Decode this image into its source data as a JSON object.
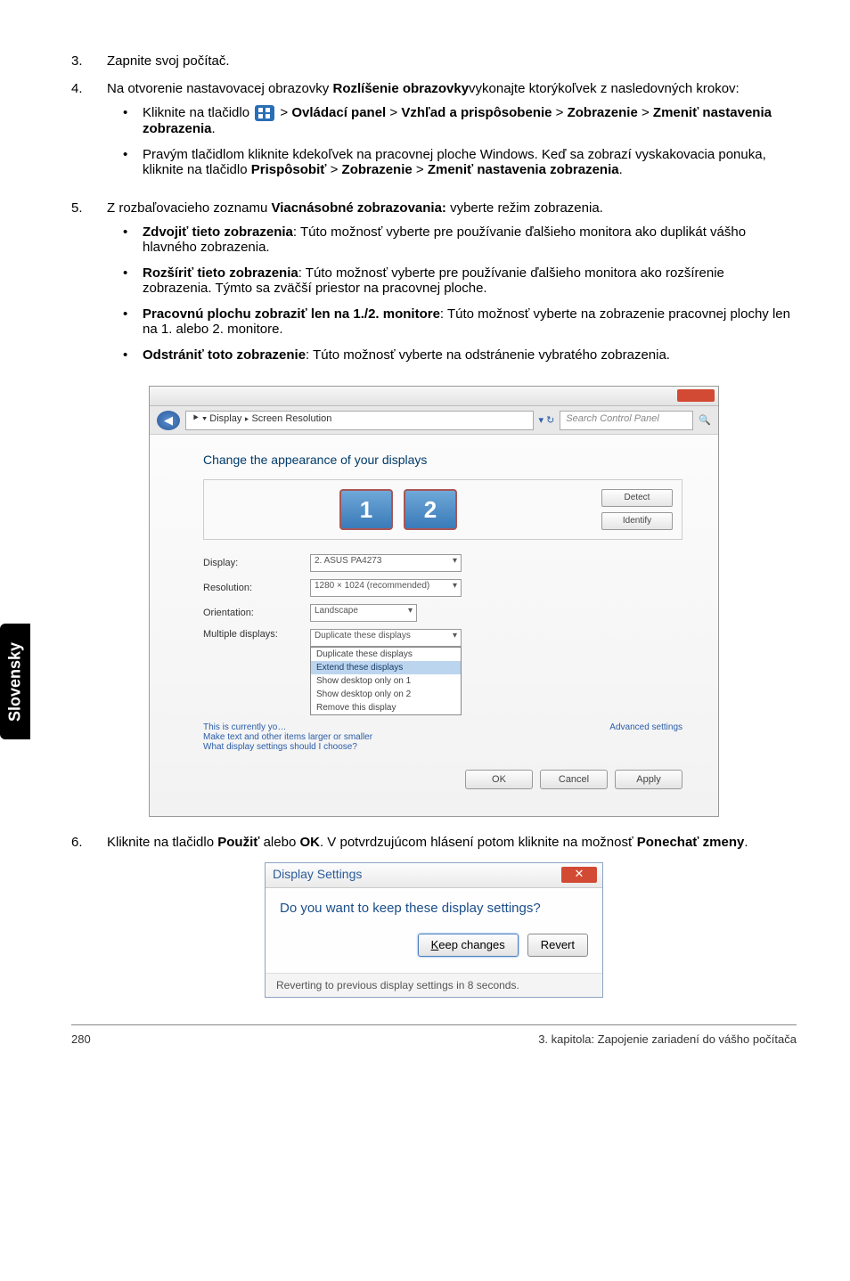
{
  "sideTab": "Slovensky",
  "steps": {
    "s3": {
      "num": "3.",
      "text": "Zapnite svoj počítač."
    },
    "s4": {
      "num": "4.",
      "textA": "Na otvorenie nastavovacej obrazovky ",
      "bold1": "Rozlíšenie obrazovky",
      "textB": "vykonajte ktorýkoľvek z nasledovných krokov:",
      "sub1": {
        "a": "Kliknite na tlačidlo ",
        "b": " > ",
        "c": "Ovládací panel",
        "d": " > ",
        "e": "Vzhľad a prispôsobenie",
        "f": " > ",
        "g": "Zobrazenie",
        "h": " > ",
        "i": "Zmeniť nastavenia zobrazenia",
        "j": "."
      },
      "sub2": {
        "a": "Pravým tlačidlom kliknite kdekoľvek na pracovnej ploche Windows. Keď sa zobrazí vyskakovacia ponuka, kliknite na tlačidlo ",
        "b": "Prispôsobiť",
        "c": " > ",
        "d": "Zobrazenie",
        "e": " > ",
        "f": "Zmeniť nastavenia zobrazenia",
        "g": "."
      }
    },
    "s5": {
      "num": "5.",
      "textA": "Z rozbaľovacieho zoznamu ",
      "bold1": "Viacnásobné zobrazovania:",
      "textB": " vyberte režim zobrazenia.",
      "opts": {
        "o1": {
          "b": "Zdvojiť tieto zobrazenia",
          "t": ": Túto možnosť vyberte pre používanie ďalšieho monitora ako duplikát vášho hlavného zobrazenia."
        },
        "o2": {
          "b": "Rozšíriť tieto zobrazenia",
          "t": ": Túto možnosť vyberte pre používanie ďalšieho monitora ako rozšírenie zobrazenia. Týmto sa zväčší priestor na pracovnej ploche."
        },
        "o3": {
          "b": "Pracovnú plochu zobraziť len na 1./2. monitore",
          "t": ": Túto možnosť vyberte na zobrazenie pracovnej plochy len na 1. alebo 2. monitore."
        },
        "o4": {
          "b": "Odstrániť toto zobrazenie",
          "t": ": Túto možnosť vyberte na odstránenie vybratého zobrazenia."
        }
      }
    },
    "s6": {
      "num": "6.",
      "a": "Kliknite na tlačidlo ",
      "b": "Použiť",
      "c": " alebo ",
      "d": "OK",
      "e": ". V potvrdzujúcom hlásení potom kliknite na možnosť ",
      "f": "Ponechať zmeny",
      "g": "."
    }
  },
  "ss1": {
    "breadcrumb": "⯈ ▾ Display ▸ Screen Resolution",
    "searchPlaceholder": "Search Control Panel",
    "heading": "Change the appearance of your displays",
    "mon1": "1",
    "mon2": "2",
    "btnDetect": "Detect",
    "btnIdentify": "Identify",
    "lblDisplay": "Display:",
    "valDisplay": "2. ASUS PA4273",
    "lblResolution": "Resolution:",
    "valResolution": "1280 × 1024 (recommended)",
    "lblOrientation": "Orientation:",
    "valOrientation": "Landscape",
    "lblMultiple": "Multiple displays:",
    "ddSelected": "Duplicate these displays",
    "dd2": "Extend these displays",
    "dd3": "Show desktop only on 1",
    "dd4": "Show desktop only on 2",
    "dd5": "Remove this display",
    "note1": "This is currently yo…",
    "note2": "Make text and other items larger or smaller",
    "note3": "What display settings should I choose?",
    "advanced": "Advanced settings",
    "ok": "OK",
    "cancel": "Cancel",
    "apply": "Apply"
  },
  "ss2": {
    "title": "Display Settings",
    "question": "Do you want to keep these display settings?",
    "keep": "Keep changes",
    "revert": "Revert",
    "footer": "Reverting to previous display settings in 8 seconds."
  },
  "footer": {
    "page": "280",
    "chapter": "3. kapitola: Zapojenie zariadení do vášho počítača"
  }
}
